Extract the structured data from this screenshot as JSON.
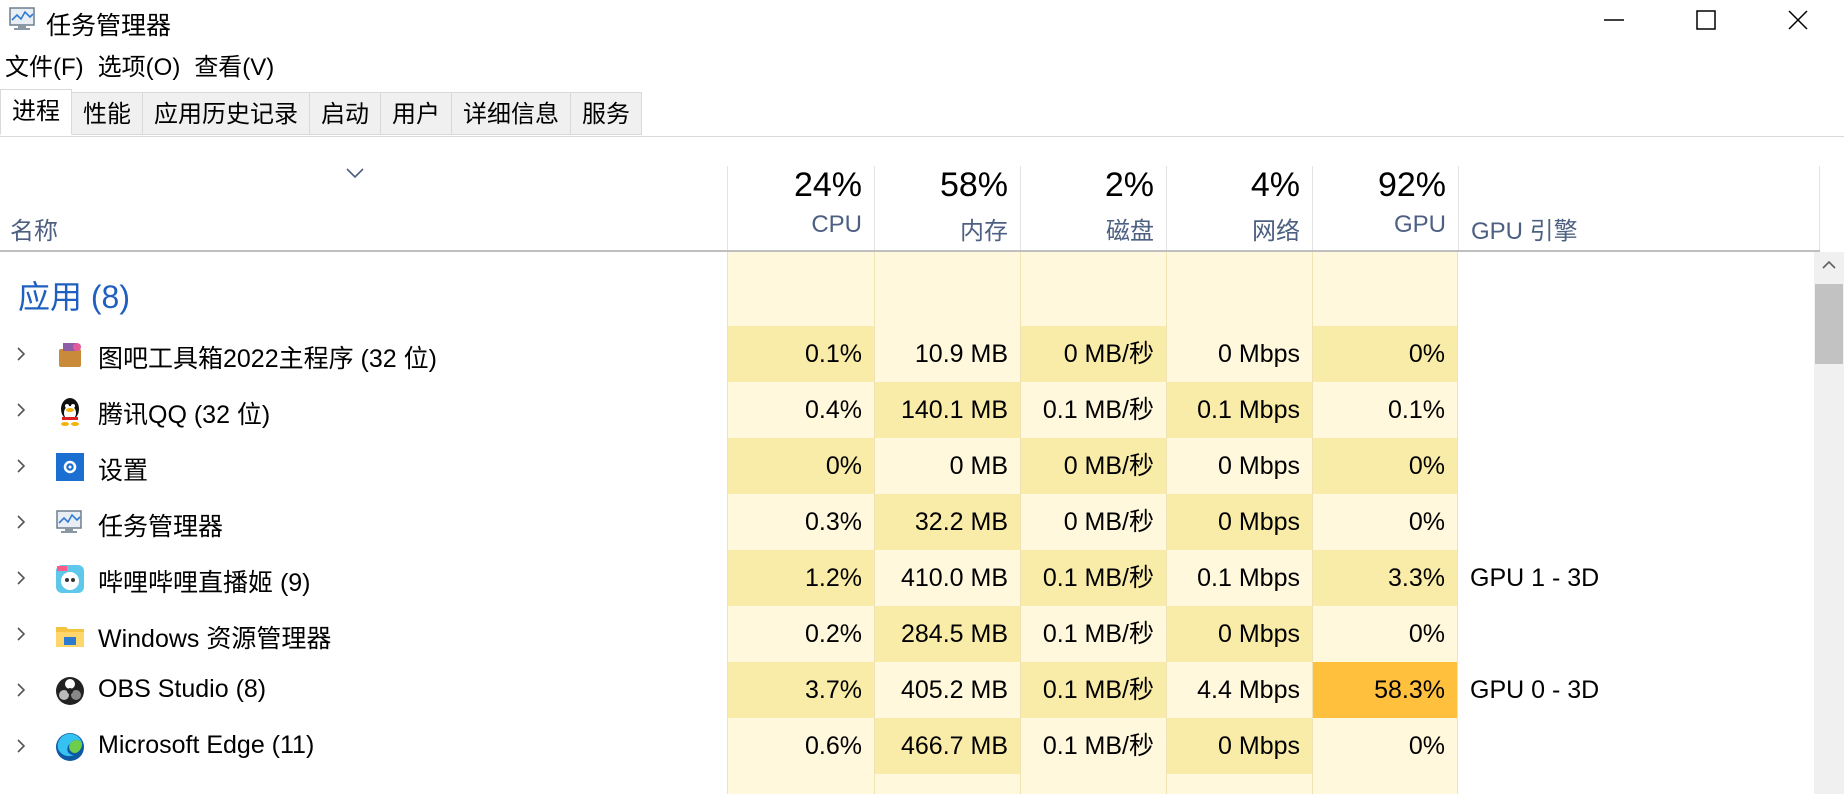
{
  "window": {
    "title": "任务管理器"
  },
  "menu": [
    "文件(F)",
    "选项(O)",
    "查看(V)"
  ],
  "tabs": [
    "进程",
    "性能",
    "应用历史记录",
    "启动",
    "用户",
    "详细信息",
    "服务"
  ],
  "active_tab": "进程",
  "header": {
    "name": "名称",
    "columns": [
      {
        "pct": "24%",
        "label": "CPU"
      },
      {
        "pct": "58%",
        "label": "内存"
      },
      {
        "pct": "2%",
        "label": "磁盘"
      },
      {
        "pct": "4%",
        "label": "网络"
      },
      {
        "pct": "92%",
        "label": "GPU"
      },
      {
        "pct": "",
        "label": "GPU 引擎"
      }
    ]
  },
  "group": {
    "title": "应用 (8)"
  },
  "processes": [
    {
      "name": "图吧工具箱2022主程序 (32 位)",
      "icon": "toolbox-icon",
      "cpu": "0.1%",
      "mem": "10.9 MB",
      "disk": "0 MB/秒",
      "net": "0 Mbps",
      "gpu": "0%",
      "engine": ""
    },
    {
      "name": "腾讯QQ (32 位)",
      "icon": "qq-penguin-icon",
      "cpu": "0.4%",
      "mem": "140.1 MB",
      "disk": "0.1 MB/秒",
      "net": "0.1 Mbps",
      "gpu": "0.1%",
      "engine": ""
    },
    {
      "name": "设置",
      "icon": "settings-gear-icon",
      "cpu": "0%",
      "mem": "0 MB",
      "disk": "0 MB/秒",
      "net": "0 Mbps",
      "gpu": "0%",
      "engine": ""
    },
    {
      "name": "任务管理器",
      "icon": "task-manager-icon",
      "cpu": "0.3%",
      "mem": "32.2 MB",
      "disk": "0 MB/秒",
      "net": "0 Mbps",
      "gpu": "0%",
      "engine": ""
    },
    {
      "name": "哔哩哔哩直播姬 (9)",
      "icon": "bilibili-live-icon",
      "cpu": "1.2%",
      "mem": "410.0 MB",
      "disk": "0.1 MB/秒",
      "net": "0.1 Mbps",
      "gpu": "3.3%",
      "engine": "GPU 1 - 3D"
    },
    {
      "name": "Windows 资源管理器",
      "icon": "folder-icon",
      "cpu": "0.2%",
      "mem": "284.5 MB",
      "disk": "0.1 MB/秒",
      "net": "0 Mbps",
      "gpu": "0%",
      "engine": ""
    },
    {
      "name": "OBS Studio (8)",
      "icon": "obs-icon",
      "cpu": "3.7%",
      "mem": "405.2 MB",
      "disk": "0.1 MB/秒",
      "net": "4.4 Mbps",
      "gpu": "58.3%",
      "engine": "GPU 0 - 3D"
    },
    {
      "name": "Microsoft Edge (11)",
      "icon": "edge-icon",
      "cpu": "0.6%",
      "mem": "466.7 MB",
      "disk": "0.1 MB/秒",
      "net": "0 Mbps",
      "gpu": "0%",
      "engine": ""
    }
  ],
  "colors": {
    "heat_low": "#fff4c4",
    "heat_mid": "#f9eca8",
    "heat_high": "#ffc13d",
    "header_label": "#4d6082",
    "group_title": "#1f5fbf"
  }
}
